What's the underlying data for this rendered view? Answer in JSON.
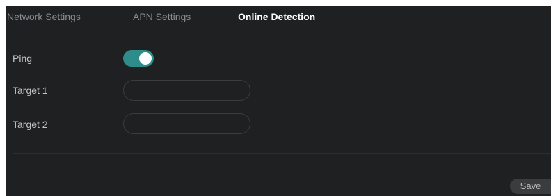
{
  "tabs": [
    {
      "label": "Network Settings",
      "active": false
    },
    {
      "label": "APN Settings",
      "active": false
    },
    {
      "label": "Online Detection",
      "active": true
    }
  ],
  "form": {
    "ping": {
      "label": "Ping",
      "enabled": true
    },
    "target1": {
      "label": "Target 1",
      "value": "",
      "placeholder": ""
    },
    "target2": {
      "label": "Target 2",
      "value": "",
      "placeholder": ""
    }
  },
  "actions": {
    "save_label": "Save"
  },
  "colors": {
    "panel_background": "#1f2021",
    "toggle_on": "#2e8d8a",
    "active_tab_text": "#ffffff",
    "inactive_tab_text": "#8a8d90"
  }
}
